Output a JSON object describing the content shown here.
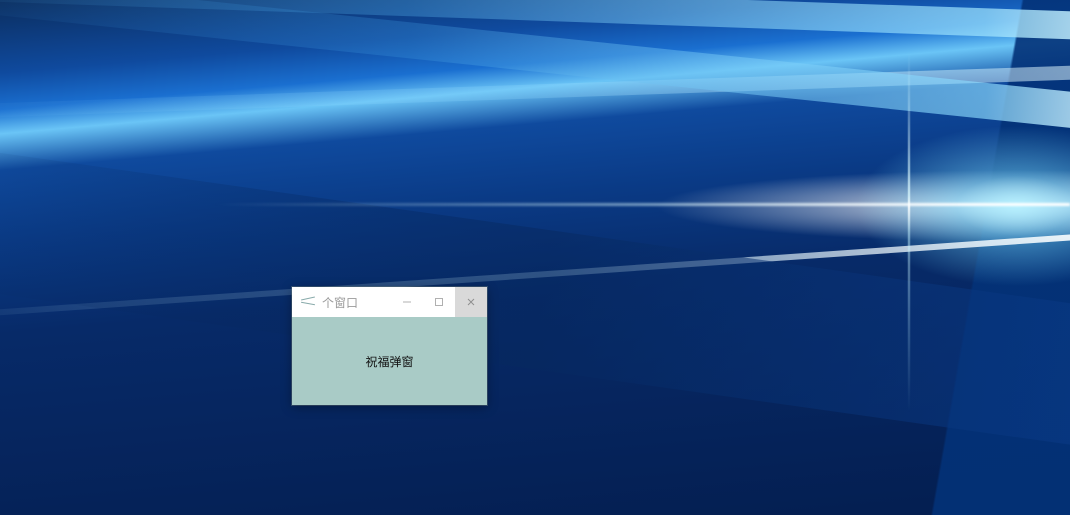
{
  "popup": {
    "title": "个窗口",
    "button_label": "祝福弹窗"
  }
}
